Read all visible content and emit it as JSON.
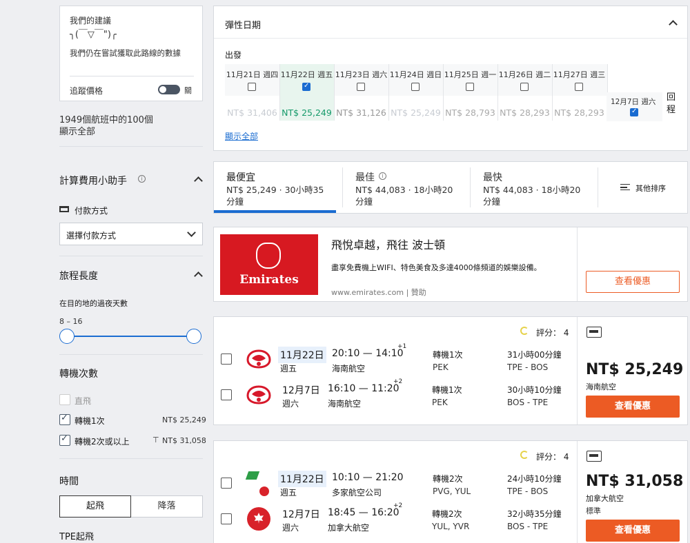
{
  "sidebar": {
    "advice_title": "我們的建議",
    "advice_face": "╮(￣▽￣\")╭",
    "advice_text": "我們仍在嘗試獲取此路線的數據",
    "track_label": "追蹤價格",
    "track_state": "關",
    "count_text": "1949個航班中的100個",
    "show_all": "顯示全部",
    "calc_title": "計算費用小助手",
    "payment_label": "付款方式",
    "payment_select": "選擇付款方式",
    "trip_title": "旅程長度",
    "nights_label": "在目的地的過夜天數",
    "nights_range": "8 – 16",
    "stops_title": "轉機次數",
    "stops": [
      {
        "label": "直飛",
        "price": "",
        "checked": false
      },
      {
        "label": "轉機1次",
        "price": "NT$ 25,249",
        "checked": true
      },
      {
        "label": "轉機2次或以上",
        "price": "NT$ 31,058",
        "checked": true
      }
    ],
    "time_title": "時間",
    "time_tabs": [
      "起飛",
      "降落"
    ],
    "tpe_depart": "TPE起飛"
  },
  "flex": {
    "title": "彈性日期",
    "depart_label": "出發",
    "dates": [
      {
        "label": "11月21日 週四",
        "price": "NT$ 31,406",
        "checked": false
      },
      {
        "label": "11月22日 週五",
        "price": "NT$ 25,249",
        "checked": true
      },
      {
        "label": "11月23日 週六",
        "price": "NT$ 31,126",
        "checked": false
      },
      {
        "label": "11月24日 週日",
        "price": "NT$ 25,249",
        "checked": false
      },
      {
        "label": "11月25日 週一",
        "price": "NT$ 28,793",
        "checked": false
      },
      {
        "label": "11月26日 週二",
        "price": "NT$ 28,293",
        "checked": false
      },
      {
        "label": "11月27日 週三",
        "price": "NT$ 28,293",
        "checked": false
      }
    ],
    "return_date": "12月7日 週六",
    "return_label": "回程",
    "show_all": "顯示全部"
  },
  "sort": {
    "tabs": [
      {
        "title": "最便宜",
        "detail": "NT$ 25,249 · 30小時35分鐘"
      },
      {
        "title": "最佳",
        "detail": "NT$ 44,083 · 18小時20分鐘"
      },
      {
        "title": "最快",
        "detail": "NT$ 44,083 · 18小時20分鐘"
      }
    ],
    "other": "其他排序"
  },
  "ad": {
    "brand": "Emirates",
    "headline": "飛悅卓越，飛往 波士頓",
    "desc": "盡享免費機上WIFI、特色美食及多達4000條頻道的娛樂設備。",
    "source": "www.emirates.com | 贊助",
    "cta": "查看優惠"
  },
  "results": [
    {
      "score": "評分： 4",
      "price": "NT$ 25,249",
      "airline": "海南航空",
      "sub": "",
      "cta": "查看優惠",
      "legs": [
        {
          "date": "11月22日",
          "dow": "週五",
          "time": "20:10 — 14:10",
          "plus": "+1",
          "carrier": "海南航空",
          "stops": "轉機1次",
          "via": "PEK",
          "dur": "31小時00分鐘",
          "route": "TPE ‐ BOS"
        },
        {
          "date": "12月7日",
          "dow": "週六",
          "time": "16:10 — 11:20",
          "plus": "+2",
          "carrier": "海南航空",
          "stops": "轉機1次",
          "via": "PEK",
          "dur": "30小時10分鐘",
          "route": "BOS ‐ TPE"
        }
      ]
    },
    {
      "score": "評分： 4",
      "price": "NT$ 31,058",
      "airline": "加拿大航空",
      "sub": "標準",
      "cta": "查看優惠",
      "legs": [
        {
          "date": "11月22日",
          "dow": "週五",
          "time": "10:10 — 21:20",
          "plus": "",
          "carrier": "多家航空公司",
          "stops": "轉機2次",
          "via": "PVG, YUL",
          "dur": "24小時10分鐘",
          "route": "TPE ‐ BOS"
        },
        {
          "date": "12月7日",
          "dow": "週六",
          "time": "18:45 — 16:20",
          "plus": "+2",
          "carrier": "加拿大航空",
          "stops": "轉機2次",
          "via": "YUL, YVR",
          "dur": "32小時35分鐘",
          "route": "BOS ‐ TPE"
        }
      ]
    }
  ]
}
